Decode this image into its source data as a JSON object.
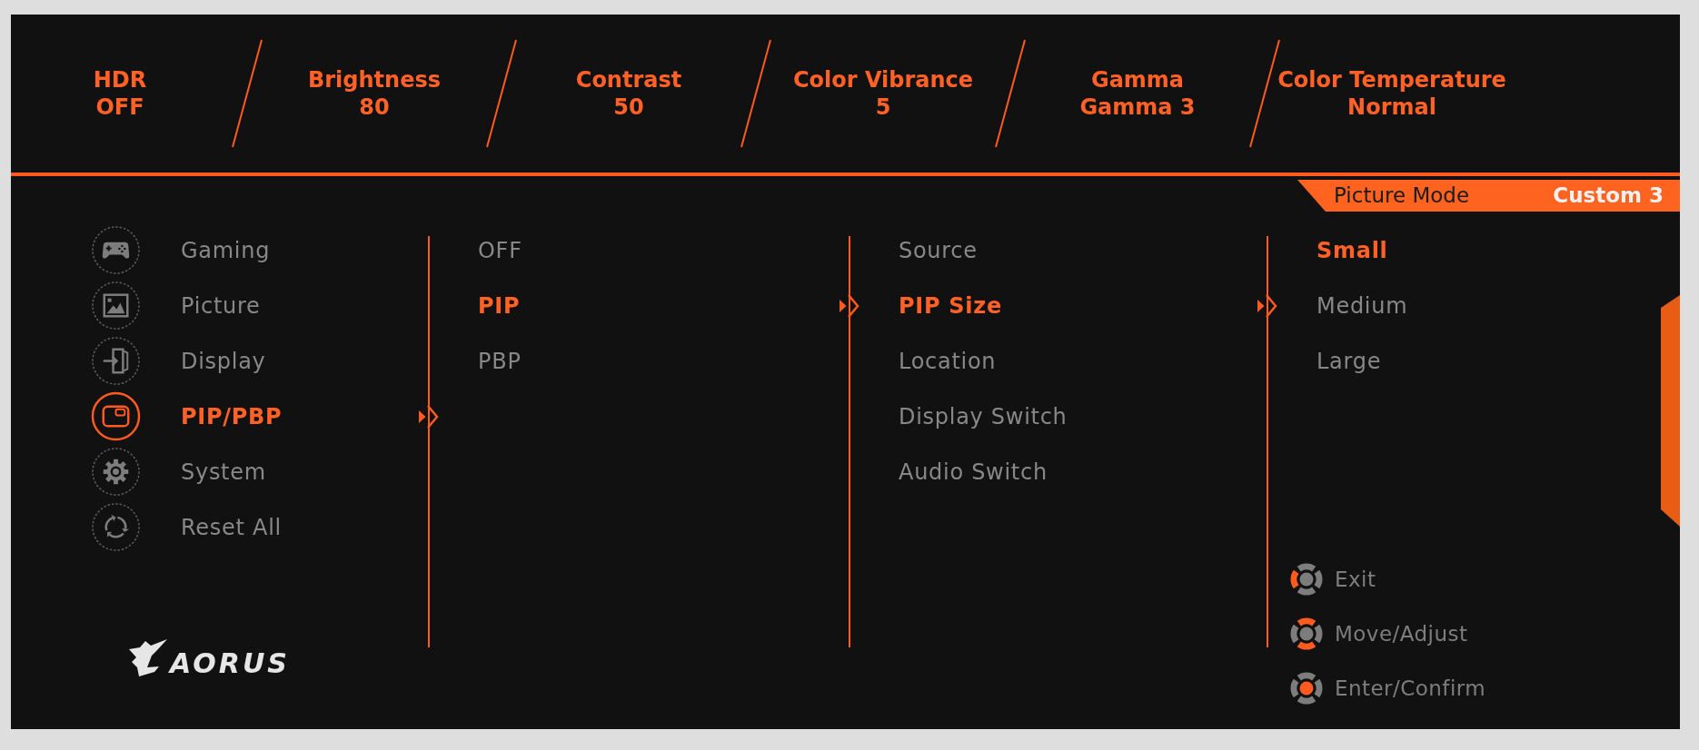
{
  "top_bar": [
    {
      "label": "HDR",
      "value": "OFF"
    },
    {
      "label": "Brightness",
      "value": "80"
    },
    {
      "label": "Contrast",
      "value": "50"
    },
    {
      "label": "Color Vibrance",
      "value": "5"
    },
    {
      "label": "Gamma",
      "value": "Gamma 3"
    },
    {
      "label": "Color Temperature",
      "value": "Normal"
    }
  ],
  "picture_mode": {
    "label": "Picture Mode",
    "value": "Custom 3"
  },
  "main_menu": [
    {
      "label": "Gaming",
      "selected": false
    },
    {
      "label": "Picture",
      "selected": false
    },
    {
      "label": "Display",
      "selected": false
    },
    {
      "label": "PIP/PBP",
      "selected": true
    },
    {
      "label": "System",
      "selected": false
    },
    {
      "label": "Reset All",
      "selected": false
    }
  ],
  "pip_mode_menu": [
    {
      "label": "OFF",
      "selected": false
    },
    {
      "label": "PIP",
      "selected": true
    },
    {
      "label": "PBP",
      "selected": false
    }
  ],
  "pip_settings_menu": [
    {
      "label": "Source",
      "selected": false
    },
    {
      "label": "PIP Size",
      "selected": true
    },
    {
      "label": "Location",
      "selected": false
    },
    {
      "label": "Display Switch",
      "selected": false
    },
    {
      "label": "Audio Switch",
      "selected": false
    }
  ],
  "pip_size_menu": [
    {
      "label": "Small",
      "selected": true
    },
    {
      "label": "Medium",
      "selected": false
    },
    {
      "label": "Large",
      "selected": false
    }
  ],
  "control_hints": [
    {
      "label": "Exit"
    },
    {
      "label": "Move/Adjust"
    },
    {
      "label": "Enter/Confirm"
    }
  ],
  "logo": {
    "text": "AORUS"
  }
}
